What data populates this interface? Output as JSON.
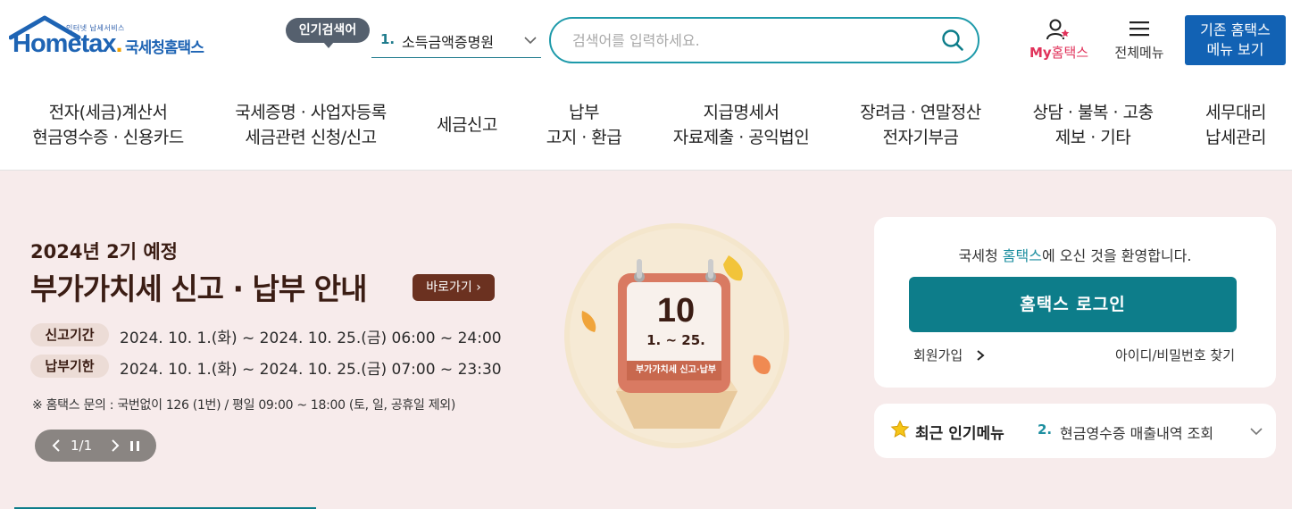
{
  "header": {
    "logo": {
      "small_text": "인터넷 납세서비스",
      "word": "Hometax",
      "dot": ".",
      "korean": "국세청홈택스"
    },
    "popular_badge": "인기검색어",
    "popular_select": {
      "number": "1.",
      "value": "소득금액증명원"
    },
    "search": {
      "placeholder": "검색어를 입력하세요."
    },
    "my_hometax": {
      "prefix": "My",
      "label": "홈택스"
    },
    "all_menu": "전체메뉴",
    "legacy_button": {
      "line1": "기존 홈택스",
      "line2": "메뉴 보기"
    }
  },
  "gnb": [
    {
      "line1": "전자(세금)계산서",
      "line2": "현금영수증 · 신용카드"
    },
    {
      "line1": "국세증명 · 사업자등록",
      "line2": "세금관련 신청/신고"
    },
    {
      "line1": "세금신고",
      "line2": ""
    },
    {
      "line1": "납부",
      "line2": "고지 · 환급"
    },
    {
      "line1": "지급명세서",
      "line2": "자료제출 · 공익법인"
    },
    {
      "line1": "장려금 · 연말정산",
      "line2": "전자기부금"
    },
    {
      "line1": "상담 · 불복 · 고충",
      "line2": "제보 · 기타"
    },
    {
      "line1": "세무대리",
      "line2": "납세관리"
    }
  ],
  "banner": {
    "subtitle": "2024년 2기 예정",
    "title": "부가가치세 신고 · 납부 안내",
    "go_button": "바로가기",
    "rows": [
      {
        "chip": "신고기간",
        "value": "2024. 10. 1.(화) ~ 2024. 10. 25.(금) 06:00 ~ 24:00"
      },
      {
        "chip": "납부기한",
        "value": "2024. 10. 1.(화) ~ 2024. 10. 25.(금) 07:00 ~ 23:30"
      }
    ],
    "note": "※ 홈택스 문의 : 국번없이 126 (1번) / 평일 09:00 ~ 18:00 (토, 일, 공휴일 제외)",
    "page_indicator": "1/1",
    "calendar": {
      "day": "10",
      "range": "1. ~ 25.",
      "caption": "부가가치세 신고·납부"
    }
  },
  "login": {
    "welcome_prefix": "국세청 ",
    "welcome_accent": "홈택스",
    "welcome_suffix": "에 오신 것을 환영합니다.",
    "login_button": "홈택스 로그인",
    "signup": "회원가입",
    "find_account": "아이디/비밀번호 찾기"
  },
  "recent": {
    "title": "최근 인기메뉴",
    "number": "2.",
    "item": "현금영수증 매출내역 조회"
  },
  "colors": {
    "brand_blue": "#1262b4",
    "teal": "#0d7d8a",
    "banner_bg": "#f7ebeb",
    "brown": "#6b3120"
  }
}
